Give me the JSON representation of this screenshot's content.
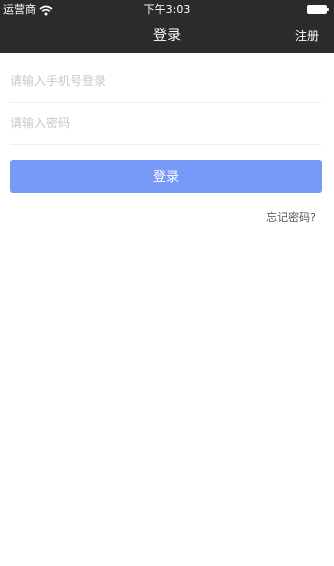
{
  "status_bar": {
    "carrier": "运营商",
    "time": "下午3:03",
    "wifi_icon": "wifi-icon",
    "battery_icon": "battery-icon"
  },
  "nav": {
    "title": "登录",
    "right_action": "注册"
  },
  "form": {
    "phone_placeholder": "请输入手机号登录",
    "phone_value": "",
    "password_placeholder": "请输入密码",
    "password_value": ""
  },
  "login_button_label": "登录",
  "forgot_password_link": "忘记密码?",
  "colors": {
    "nav_bg": "#2b2b2b",
    "primary_button": "#7799f8",
    "placeholder": "#c8c8c8",
    "divider": "#eeeeee"
  }
}
